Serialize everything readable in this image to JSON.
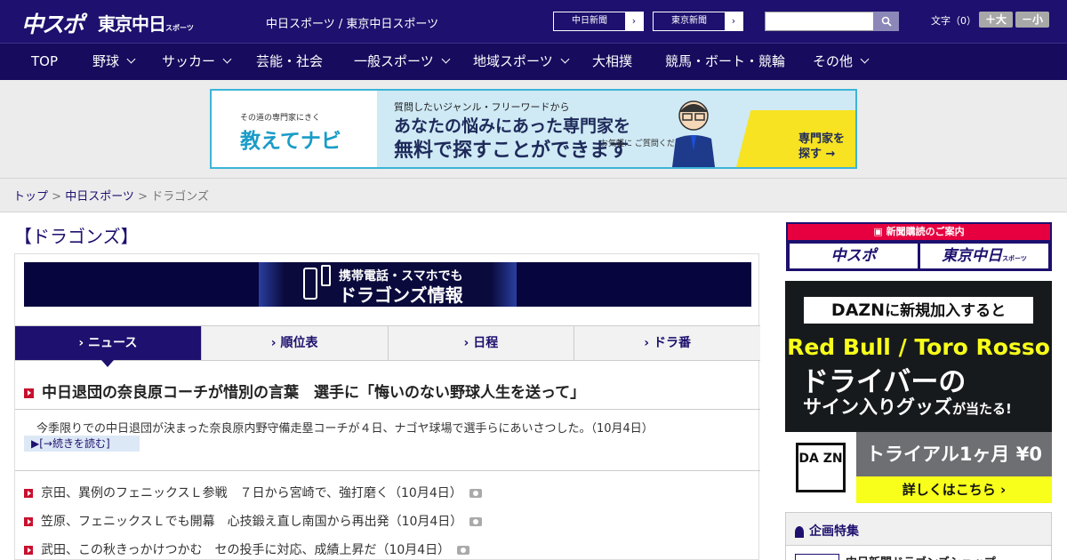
{
  "header": {
    "logo_main": "中スポ",
    "logo_tokyo": "東京中日",
    "logo_tokyo_suffix": "スポーツ",
    "site_links": "中日スポーツ / 東京中日スポーツ",
    "chunichi_button": "中日新聞",
    "tokyo_button": "東京新聞",
    "search_placeholder": "",
    "text_size_label": "文字（0）",
    "text_larger": "＋大",
    "text_smaller": "－小"
  },
  "nav": {
    "items": [
      {
        "label": "TOP"
      },
      {
        "label": "野球"
      },
      {
        "label": "サッカー"
      },
      {
        "label": "芸能・社会"
      },
      {
        "label": "一般スポーツ"
      },
      {
        "label": "地域スポーツ"
      },
      {
        "label": "大相撲"
      },
      {
        "label": "競馬・ボート・競輪"
      },
      {
        "label": "その他"
      }
    ]
  },
  "ad": {
    "small": "その道の専門家にきく",
    "brand": "教えてナビ",
    "line1": "質問したいジャンル・フリーワードから",
    "line2": "あなたの悩みにあった専門家を",
    "line3": "無料で探すことができます",
    "note": "お気軽に ご質問ください！",
    "cta": "専門家を 探す →"
  },
  "breadcrumb": {
    "top": "トップ",
    "section": "中日スポーツ",
    "current": "ドラゴンズ",
    "sep": " > "
  },
  "page": {
    "title": "【ドラゴンズ】"
  },
  "dragons_banner": {
    "line1": "携帯電話・スマホでも",
    "line2": "ドラゴンズ情報"
  },
  "tabs": [
    {
      "label": "ニュース"
    },
    {
      "label": "順位表"
    },
    {
      "label": "日程"
    },
    {
      "label": "ドラ番"
    }
  ],
  "headline": {
    "title": "中日退団の奈良原コーチが惜別の言葉　選手に「悔いのない野球人生を送って」",
    "summary": "今季限りでの中日退団が決まった奈良原内野守備走塁コーチが４日、ナゴヤ球場で選手らにあいさつした。（10月4日）",
    "more": "[→続きを読む]"
  },
  "news": [
    {
      "text": "京田、異例のフェニックスＬ参戦　７日から宮崎で、強打磨く（10月4日）"
    },
    {
      "text": "笠原、フェニックスＬでも開幕　心技鍛え直し南国から再出発（10月4日）"
    },
    {
      "text": "武田、この秋きっかけつかむ　セの投手に対応、成績上昇だ（10月4日）"
    }
  ],
  "sidebar": {
    "subscribe_head": "新聞購読のご案内",
    "sub1": "中スポ",
    "sub2": "東京中日",
    "sub2_suffix": "スポーツ",
    "dazn_top_brand": "DAZN",
    "dazn_top_rest": "に新規加入すると",
    "dazn_rb": "Red Bull / Toro Rosso",
    "dazn_drv": "ドライバーの",
    "dazn_sign": "サイン入りグッズ",
    "dazn_sign_suffix": "が当たる!",
    "dazn_logo": "DA ZN",
    "dazn_trial": "トライアル1ヶ月 ¥0",
    "dazn_more": "詳しくはこちら ›",
    "feature_head": "企画特集",
    "feature_item": "中日新聞ドラゴンズショップ"
  },
  "colors": {
    "brand_navy": "#1d106e",
    "accent_red": "#c8102e",
    "dazn_yellow": "#f7ff1a"
  }
}
